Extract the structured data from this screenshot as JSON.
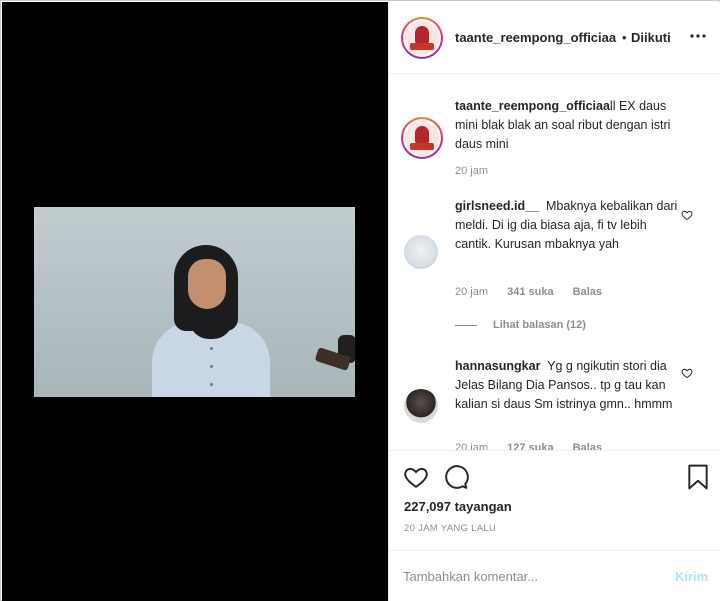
{
  "post": {
    "username": "taante_reempong_officiaa",
    "separator": "•",
    "follow_status": "Diikuti",
    "more_label": "•••"
  },
  "caption": {
    "username": "taante_reempong_officiaa",
    "text": "ll EX daus mini blak blak an soal ribut dengan istri daus mini",
    "time": "20 jam"
  },
  "comments": [
    {
      "username": "girlsneed.id__",
      "text": "Mbaknya kebalikan dari meldi. Di ig dia biasa aja, fi tv lebih cantik. Kurusan mbaknya yah",
      "time": "20 jam",
      "likes": "341 suka",
      "reply_label": "Balas",
      "view_replies": "Lihat balasan (12)"
    },
    {
      "username": "hannasungkar",
      "text": "Yg g ngikutin stori dia Jelas Bilang Dia Pansos.. tp g tau kan kalian si daus Sm istrinya gmn.. hmmm",
      "time": "20 jam",
      "likes": "127 suka",
      "reply_label": "Balas"
    }
  ],
  "stats": {
    "views": "227,097 tayangan",
    "posted": "20 JAM YANG LALU"
  },
  "composer": {
    "placeholder": "Tambahkan komentar...",
    "post_label": "Kirim"
  },
  "icons": {
    "like": "heart-icon",
    "comment": "comment-icon",
    "save": "bookmark-icon",
    "more": "more-options-icon"
  },
  "colors": {
    "text": "#262626",
    "muted": "#8e8e8e",
    "post_disabled": "#b2dffc",
    "media_bg": "#000000"
  }
}
